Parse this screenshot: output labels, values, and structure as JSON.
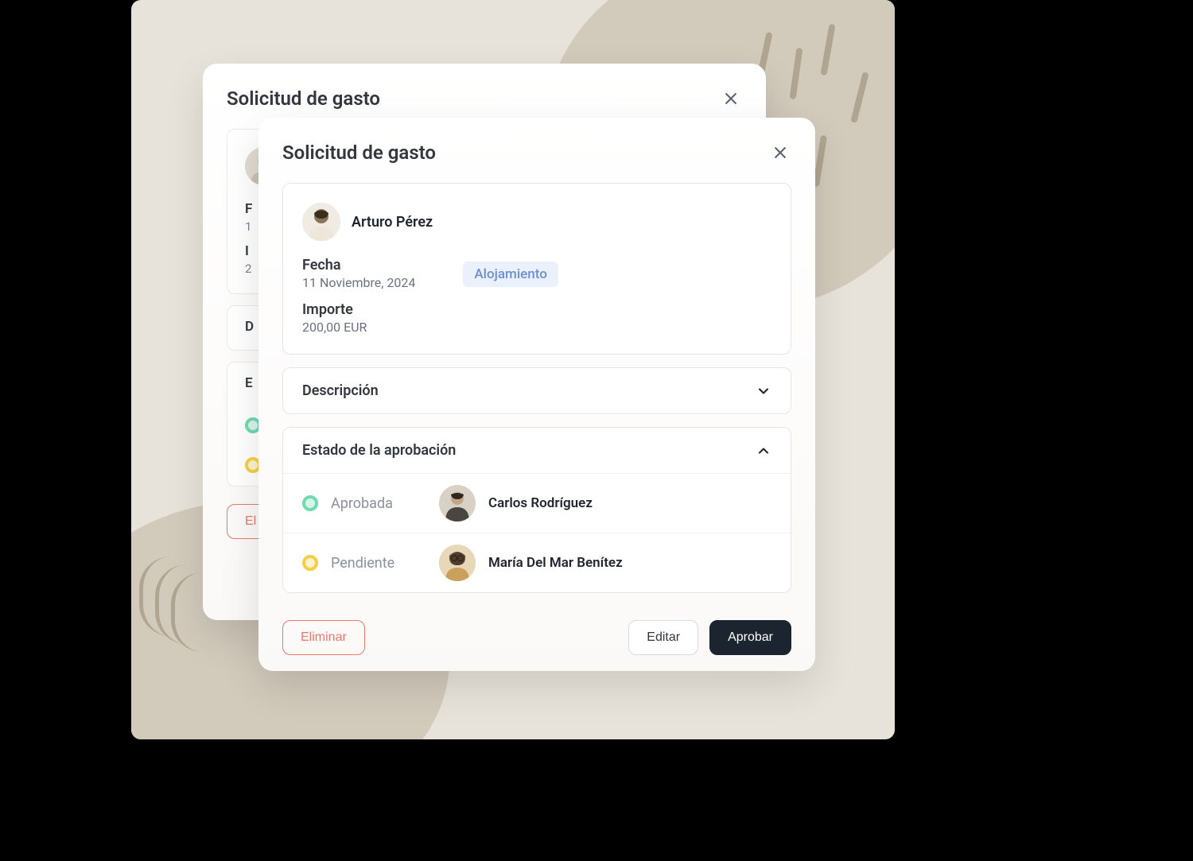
{
  "modal_back": {
    "title": "Solicitud de gasto",
    "date_label": "F",
    "date_value": "1",
    "amount_label": "I",
    "amount_value": "2",
    "description_label": "D",
    "approval_label": "E",
    "delete_label": "El"
  },
  "modal_front": {
    "title": "Solicitud de gasto",
    "requester_name": "Arturo Pérez",
    "date_label": "Fecha",
    "date_value": "11 Noviembre, 2024",
    "amount_label": "Importe",
    "amount_value": "200,00 EUR",
    "category_tag": "Alojamiento",
    "description_label": "Descripción",
    "approval_label": "Estado de la aprobación",
    "approvals": [
      {
        "status_label": "Aprobada",
        "status": "approved",
        "name": "Carlos Rodríguez"
      },
      {
        "status_label": "Pendiente",
        "status": "pending",
        "name": "María Del Mar Benítez"
      }
    ],
    "delete_label": "Eliminar",
    "edit_label": "Editar",
    "approve_label": "Aprobar"
  }
}
